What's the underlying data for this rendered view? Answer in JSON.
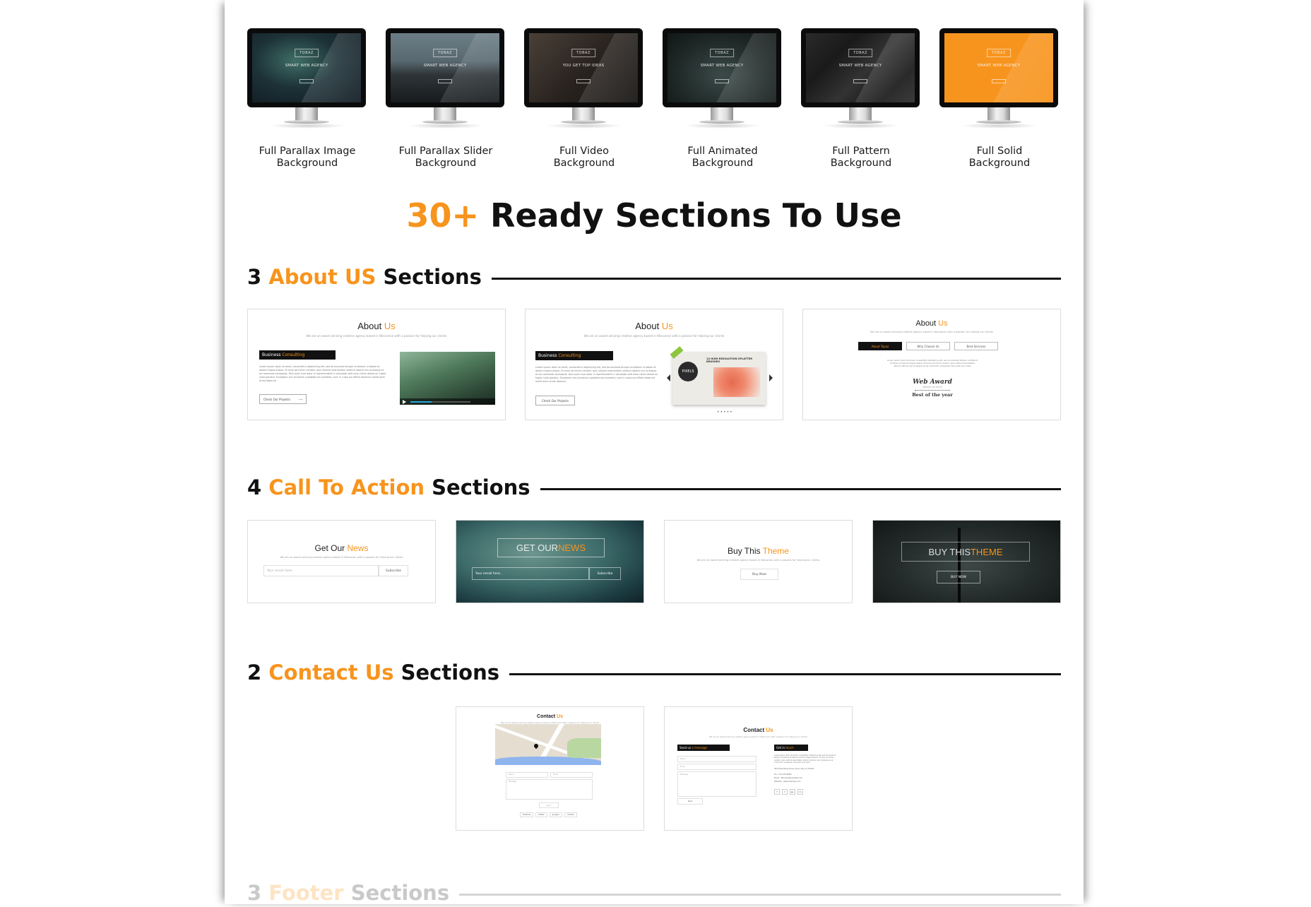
{
  "accent_color": "#f7941d",
  "backgrounds": [
    {
      "label_line1": "Full Parallax Image",
      "label_line2": "Background",
      "screen": {
        "logo": "TOBAZ",
        "tagline": "SMART WEB AGENCY"
      },
      "bg": "radial-gradient(ellipse at 40% 40%, #3f6e66 0%, #1d3238 45%, #0f1820 100%)"
    },
    {
      "label_line1": "Full Parallax Slider",
      "label_line2": "Background",
      "screen": {
        "logo": "TOBAZ",
        "tagline": "SMART WEB AGENCY"
      },
      "bg": "linear-gradient(#6c7e86 0%, #586870 40%, #2e3538 60%, #171b1d 100%)"
    },
    {
      "label_line1": "Full Video",
      "label_line2": "Background",
      "screen": {
        "logo": "TOBAZ",
        "tagline": "YOU GET TOP IDEAS"
      },
      "bg": "linear-gradient(135deg, #4a4038 0%, #2a2420 50%, #141210 100%)"
    },
    {
      "label_line1": "Full Animated",
      "label_line2": "Background",
      "screen": {
        "logo": "TOBAZ",
        "tagline": "SMART WEB AGENCY"
      },
      "bg": "radial-gradient(ellipse at 50% 60%, #3b4a48 0%, #1e2827 60%, #111716 100%)"
    },
    {
      "label_line1": "Full Pattern",
      "label_line2": "Background",
      "screen": {
        "logo": "TOBAZ",
        "tagline": "SMART WEB AGENCY"
      },
      "bg": "linear-gradient(135deg, #2a2a2a 0%, #1a1a1a 30%, #333 55%, #151515 80%, #2b2b2b 100%)"
    },
    {
      "label_line1": "Full Solid",
      "label_line2": "Background",
      "screen": {
        "logo": "TOBAZ",
        "tagline": "SMART WEB AGENCY"
      },
      "bg": "#f7941d"
    }
  ],
  "main_title": {
    "highlight": "30+",
    "rest": " Ready Sections To Use"
  },
  "sections": {
    "about": {
      "count": "3 ",
      "highlight": "About US",
      "suffix": " Sections"
    },
    "cta": {
      "count": "4 ",
      "highlight": "Call To Action",
      "suffix": " Sections"
    },
    "contact": {
      "count": "2 ",
      "highlight": "Contact Us",
      "suffix": " Sections"
    },
    "footer": {
      "count": "3 ",
      "highlight": "Footer",
      "suffix": " Sections"
    }
  },
  "about_cards": {
    "title_plain": "About ",
    "title_accent": "Us",
    "subtitle": "We are an award winning creative agency based in Wisconsin with a passion for helping our clients",
    "block_plain": "Business ",
    "block_accent": "Consulting",
    "lorem": "Lorem ipsum dolor sit amet, consectetur adipisicing elit, sed do eiusmod tempor incididunt ut labore et dolore magna aliqua. Ut enim ad minim veniam, quis nostrud exercitation ullamco laboris nisi ut aliquip ex ea commodo consequat. Duis aute irure dolor in reprehenderit in voluptate velit esse cillum dolore eu fugiat nulla pariatur. Excepteur sint occaecat cupidatat non proident, sunt in culpa qui officia deserunt mollit anim id est laborum.",
    "projects_button": "Check Our Projects",
    "arrow": "⟶",
    "slider_caption": "14 HIGH RESOLUTION SPLATTER BRUSHES",
    "slider_badge": "PIXELS",
    "tabs": [
      "About Topaz",
      "Why Choose Us",
      "Best Services"
    ],
    "tab_lorem": "Lorem ipsum dolor sit amet, consectetur adipisicing elit, sed do eiusmod tempor incididunt ut labore et dolore magna aliqua. Ut enim ad minim veniam, quis nostrud exercitation ullamco laboris nisi ut aliquip ex ea commodo consequat. Duis aute irure dolor",
    "award_title": "Web Award",
    "award_sub": "Winner of 2013",
    "award_motto": "Best of the year"
  },
  "cta_cards": {
    "news_plain": "Get Our ",
    "news_accent": "News",
    "news_plain_upper": "GET OUR ",
    "news_accent_upper": "NEWS",
    "subtitle": "We are an award winning creative agency based in Wisconsin with a passion for helping our clients",
    "email_placeholder": "Your email here..",
    "subscribe": "Subscribe",
    "buy_plain": "Buy This ",
    "buy_accent": "Theme",
    "buy_plain_upper": "BUY THIS ",
    "buy_accent_upper": "THEME",
    "buy_now": "Buy Now",
    "buy_now_upper": "BUY NOW"
  },
  "contact_cards": {
    "title_plain": "Contact ",
    "title_accent": "Us",
    "subtitle": "We are an award winning creative agency based in Wisconsin with a passion for helping our clients",
    "name": "Name",
    "email": "Email",
    "message": "Message",
    "send": "Send",
    "social": [
      "facebook",
      "twitter",
      "google+",
      "linkedin"
    ],
    "send_msg_plain": "Send us ",
    "send_msg_accent": "a message",
    "touch_plain": "Get in ",
    "touch_accent": "touch",
    "address": "4312 Woodland Drive, Sioux City, IA 51106",
    "tel": "Tel : 712-276-8489",
    "mail": "Email : Bernard@example.com",
    "website": "Website : www.example.com"
  }
}
